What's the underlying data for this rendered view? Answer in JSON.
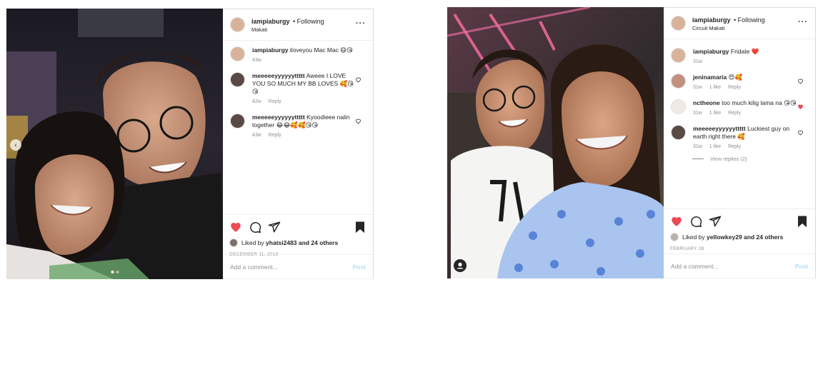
{
  "colors": {
    "like_red": "#ed4956",
    "post_btn": "#b2dffc",
    "meta_gray": "#8e8e8e"
  },
  "post1": {
    "header": {
      "username": "iampiaburgy",
      "follow": "• Following",
      "location": "Makati"
    },
    "caption": {
      "username": "iampiaburgy",
      "text": "iloveyou Mac Mac 😄😘",
      "time": "43w"
    },
    "comments": [
      {
        "username": "meeeeeyyyyyyttttt",
        "text": "Aweee I LOVE YOU SO MUCH MY BB LOVES 🥰😘😘",
        "time": "42w",
        "reply": "Reply"
      },
      {
        "username": "meeeeeyyyyyyttttt",
        "text": "Kyoodieee nalin together 😂😂🥰🥰😘😘",
        "time": "43w",
        "reply": "Reply"
      }
    ],
    "liked_by": {
      "prefix": "Liked by",
      "user": "yhatsi2483",
      "suffix": "and 24 others"
    },
    "date": "DECEMBER 11, 2018",
    "add_comment_placeholder": "Add a comment...",
    "post_label": "Post",
    "icons": [
      "heart-filled-icon",
      "comment-icon",
      "share-icon",
      "bookmark-icon",
      "more-icon",
      "chevron-left-icon"
    ]
  },
  "post2": {
    "header": {
      "username": "iampiaburgy",
      "follow": "• Following",
      "location": "Circuit Makati"
    },
    "caption": {
      "username": "iampiaburgy",
      "text": "Fridate ❤️",
      "time": "31w"
    },
    "comments": [
      {
        "username": "jeninamaria",
        "text": "😍🥰",
        "time": "31w",
        "likes": "1 like",
        "reply": "Reply"
      },
      {
        "username": "nctheone",
        "text": "too much kilig lama na 😘😘",
        "time": "31w",
        "likes": "1 like",
        "reply": "Reply",
        "liked": true
      },
      {
        "username": "meeeeeyyyyyyttttt",
        "text": "Luckiest guy on earth right there 🥰",
        "time": "31w",
        "likes": "1 like",
        "reply": "Reply"
      }
    ],
    "view_replies": "View replies (2)",
    "liked_by": {
      "prefix": "Liked by",
      "user": "yellowkey29",
      "suffix": "and 24 others"
    },
    "date": "FEBRUARY 28",
    "add_comment_placeholder": "Add a comment...",
    "post_label": "Post",
    "icons": [
      "heart-filled-icon",
      "comment-icon",
      "share-icon",
      "bookmark-icon",
      "more-icon",
      "user-tag-icon"
    ]
  }
}
